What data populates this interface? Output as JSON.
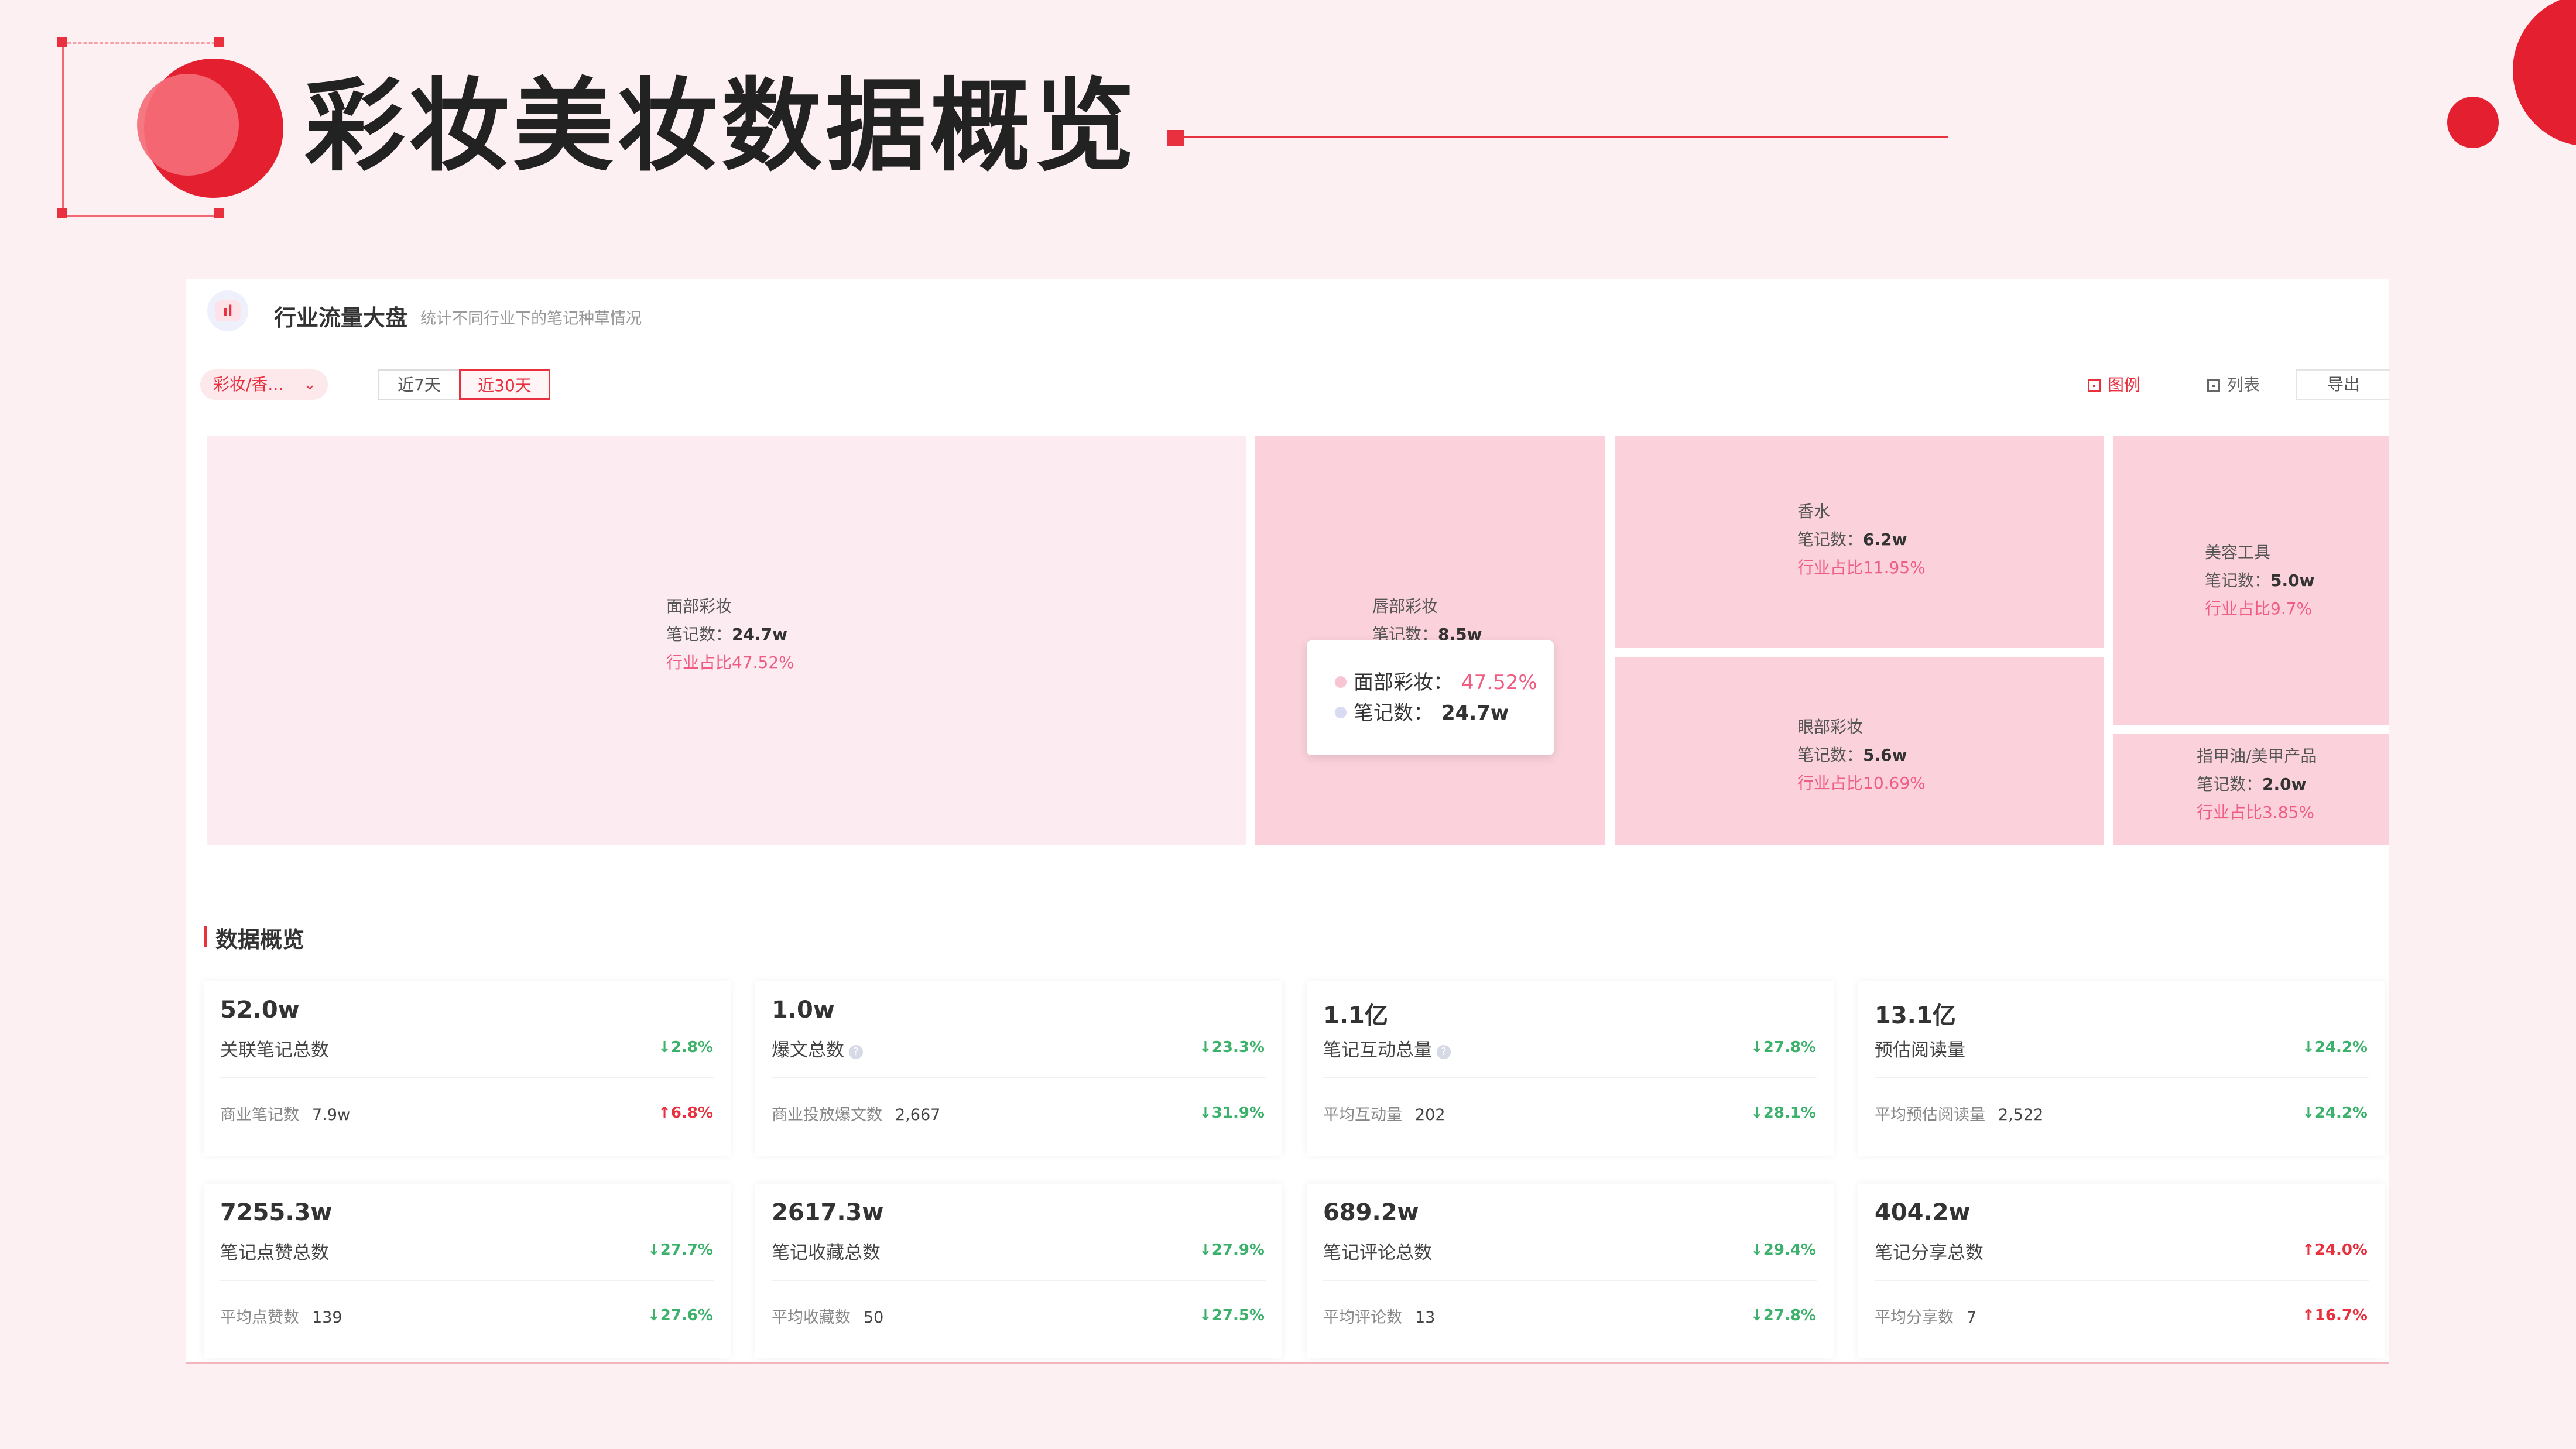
{
  "slide": {
    "title": "彩妆美妆数据概览"
  },
  "panel": {
    "header": {
      "title": "行业流量大盘",
      "description": "统计不同行业下的笔记种草情况"
    },
    "filter": {
      "category": "彩妆/香...",
      "periods": [
        "近7天",
        "近30天"
      ],
      "active_period": "近30天"
    },
    "toolbar": {
      "legend_label": "图例",
      "list_label": "列表",
      "export_label": "导出"
    },
    "treemap": {
      "tiles": [
        {
          "name": "面部彩妆",
          "count_label": "笔记数：",
          "count": "24.7w",
          "share": "行业占比47.52%"
        },
        {
          "name": "唇部彩妆",
          "count_label": "笔记数：",
          "count": "8.5w",
          "share": ""
        },
        {
          "name": "香水",
          "count_label": "笔记数：",
          "count": "6.2w",
          "share": "行业占比11.95%"
        },
        {
          "name": "眼部彩妆",
          "count_label": "笔记数：",
          "count": "5.6w",
          "share": "行业占比10.69%"
        },
        {
          "name": "美容工具",
          "count_label": "笔记数：",
          "count": "5.0w",
          "share": "行业占比9.7%"
        },
        {
          "name": "指甲油/美甲产品",
          "count_label": "笔记数：",
          "count": "2.0w",
          "share": "行业占比3.85%"
        }
      ],
      "tooltip": {
        "line1_label": "面部彩妆：",
        "line1_value": "47.52%",
        "line2_label": "笔记数：",
        "line2_value": "24.7w",
        "dot1_color": "#f7c6d2",
        "dot2_color": "#d8dbf2"
      }
    },
    "overview": {
      "title": "数据概览",
      "cards": [
        {
          "value": "52.0w",
          "name": "关联笔记总数",
          "trend": "↓2.8%",
          "trend_dir": "down",
          "sub_label": "商业笔记数",
          "sub_value": "7.9w",
          "sub_trend": "↑6.8%",
          "sub_trend_dir": "up",
          "info": false
        },
        {
          "value": "1.0w",
          "name": "爆文总数",
          "trend": "↓23.3%",
          "trend_dir": "down",
          "sub_label": "商业投放爆文数",
          "sub_value": "2,667",
          "sub_trend": "↓31.9%",
          "sub_trend_dir": "down",
          "info": true
        },
        {
          "value": "1.1亿",
          "name": "笔记互动总量",
          "trend": "↓27.8%",
          "trend_dir": "down",
          "sub_label": "平均互动量",
          "sub_value": "202",
          "sub_trend": "↓28.1%",
          "sub_trend_dir": "down",
          "info": true
        },
        {
          "value": "13.1亿",
          "name": "预估阅读量",
          "trend": "↓24.2%",
          "trend_dir": "down",
          "sub_label": "平均预估阅读量",
          "sub_value": "2,522",
          "sub_trend": "↓24.2%",
          "sub_trend_dir": "down",
          "info": false
        },
        {
          "value": "7255.3w",
          "name": "笔记点赞总数",
          "trend": "↓27.7%",
          "trend_dir": "down",
          "sub_label": "平均点赞数",
          "sub_value": "139",
          "sub_trend": "↓27.6%",
          "sub_trend_dir": "down",
          "info": false
        },
        {
          "value": "2617.3w",
          "name": "笔记收藏总数",
          "trend": "↓27.9%",
          "trend_dir": "down",
          "sub_label": "平均收藏数",
          "sub_value": "50",
          "sub_trend": "↓27.5%",
          "sub_trend_dir": "down",
          "info": false
        },
        {
          "value": "689.2w",
          "name": "笔记评论总数",
          "trend": "↓29.4%",
          "trend_dir": "down",
          "sub_label": "平均评论数",
          "sub_value": "13",
          "sub_trend": "↓27.8%",
          "sub_trend_dir": "down",
          "info": false
        },
        {
          "value": "404.2w",
          "name": "笔记分享总数",
          "trend": "↑24.0%",
          "trend_dir": "up",
          "sub_label": "平均分享数",
          "sub_value": "7",
          "sub_trend": "↑16.7%",
          "sub_trend_dir": "up",
          "info": false
        }
      ]
    }
  },
  "colors": {
    "accent": "#e8303f",
    "tile_pink": "#fbd2db",
    "tile_light": "#fdebf2",
    "share_text": "#f05d83",
    "trend_down": "#3bb16b",
    "trend_up": "#e8303f",
    "background": "#fdf0f2"
  },
  "icons": {
    "header_icon": "bar-chart-icon",
    "dropdown_icon": "chevron-down-icon",
    "legend_icon": "legend-icon",
    "list_icon": "list-icon",
    "info_icon": "question-mark-icon"
  }
}
